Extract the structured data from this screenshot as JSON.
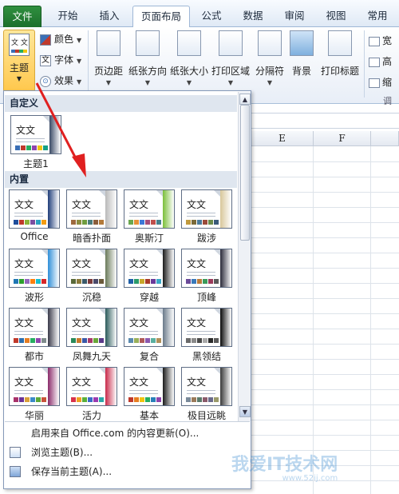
{
  "tabs": [
    "文件",
    "开始",
    "插入",
    "页面布局",
    "公式",
    "数据",
    "审阅",
    "视图",
    "常用"
  ],
  "ribbon": {
    "theme_button": "主题",
    "theme_icon_text": "文 文",
    "small_options": [
      "颜色",
      "字体",
      "效果"
    ],
    "small_option_glyphs": [
      "文",
      "⊙"
    ],
    "big_buttons": [
      "页边距",
      "纸张方向",
      "纸张大小",
      "打印区域",
      "分隔符",
      "背景",
      "打印标题"
    ],
    "right_options": [
      "宽",
      "高",
      "缩"
    ],
    "group_label": "调整"
  },
  "columns": [
    "E",
    "F"
  ],
  "gallery": {
    "section_custom": "自定义",
    "section_builtin": "内置",
    "thumb_text": "文文",
    "custom_themes": [
      {
        "name": "主题1",
        "side": "#3a4a66",
        "colors": [
          "#3b6fb5",
          "#c0392b",
          "#27ae60",
          "#8e44ad",
          "#f1c40f",
          "#16a085"
        ]
      }
    ],
    "builtin_themes": [
      {
        "name": "Office",
        "side": "#1f3d7a",
        "colors": [
          "#1f4e9c",
          "#c0392b",
          "#8bb43a",
          "#7b4fa0",
          "#2aa1c0",
          "#f39c12"
        ]
      },
      {
        "name": "暗香扑面",
        "side": "#b9b9b9",
        "colors": [
          "#9e6a3f",
          "#8c8c3f",
          "#6f9c3f",
          "#4a7d7d",
          "#8b5e3c",
          "#b37a3a"
        ]
      },
      {
        "name": "奥斯汀",
        "side": "#7bbf3a",
        "colors": [
          "#6aa84f",
          "#e69138",
          "#3c78d8",
          "#a64d79",
          "#c0504d",
          "#45818e"
        ]
      },
      {
        "name": "跋涉",
        "side": "#d8c79a",
        "colors": [
          "#c19a3e",
          "#7a6a3a",
          "#4a7a9a",
          "#9a4a3a",
          "#6a8a4a",
          "#3a5a7a"
        ]
      },
      {
        "name": "波形",
        "side": "#2f8fd8",
        "colors": [
          "#1f77b4",
          "#2ca02c",
          "#9467bd",
          "#ff7f0e",
          "#17becf",
          "#d62728"
        ]
      },
      {
        "name": "沉稳",
        "side": "#6a7a5a",
        "colors": [
          "#5a6a3a",
          "#8a7a3a",
          "#3a5a6a",
          "#7a3a3a",
          "#4a4a6a",
          "#6a5a3a"
        ]
      },
      {
        "name": "穿越",
        "side": "#1a1a1a",
        "colors": [
          "#1f5fa8",
          "#2a9a6a",
          "#c8a82a",
          "#a83a2a",
          "#6a3a9a",
          "#3aa8c8"
        ]
      },
      {
        "name": "顶峰",
        "side": "#2a2a3a",
        "colors": [
          "#6a4a9a",
          "#3a7aba",
          "#ba7a3a",
          "#3a9a5a",
          "#9a3a5a",
          "#5a5a5a"
        ]
      },
      {
        "name": "都市",
        "side": "#3a3a4a",
        "colors": [
          "#c0392b",
          "#2c6fb0",
          "#e67e22",
          "#27ae60",
          "#8e44ad",
          "#7f8c8d"
        ]
      },
      {
        "name": "凤舞九天",
        "side": "#2a5a5a",
        "colors": [
          "#2a8a5a",
          "#c8782a",
          "#3a5aa8",
          "#a83a6a",
          "#6aa83a",
          "#5a3a8a"
        ]
      },
      {
        "name": "复合",
        "side": "#6a7a8a",
        "colors": [
          "#5a8ab0",
          "#9ab05a",
          "#b05a5a",
          "#8a5ab0",
          "#5ab0a0",
          "#b0905a"
        ]
      },
      {
        "name": "黑领结",
        "side": "#0a0a0a",
        "colors": [
          "#6a6a6a",
          "#8a8a8a",
          "#4a4a4a",
          "#aaaaaa",
          "#2a2a2a",
          "#5a5a5a"
        ]
      },
      {
        "name": "华丽",
        "side": "#8a2a6a",
        "colors": [
          "#a8326a",
          "#6a3298",
          "#d8a03a",
          "#3a8ac8",
          "#5aa83a",
          "#c8543a"
        ]
      },
      {
        "name": "活力",
        "side": "#c82a4a",
        "colors": [
          "#d8324a",
          "#f0a020",
          "#5ab03a",
          "#3a6ac8",
          "#9a3ab0",
          "#2aa8a8"
        ]
      },
      {
        "name": "基本",
        "side": "#1a1a1a",
        "colors": [
          "#c0392b",
          "#e67e22",
          "#f1c40f",
          "#27ae60",
          "#2980b9",
          "#8e44ad"
        ]
      },
      {
        "name": "极目远眺",
        "side": "#3a3a3a",
        "colors": [
          "#7a8a9a",
          "#9a7a5a",
          "#5a7a6a",
          "#8a5a6a",
          "#6a6a8a",
          "#9a9a6a"
        ]
      }
    ],
    "menu": [
      {
        "label": "启用来自 Office.com 的内容更新(O)...",
        "icon": "none"
      },
      {
        "label": "浏览主题(B)...",
        "icon": "browse-icon"
      },
      {
        "label": "保存当前主题(A)...",
        "icon": "save-icon"
      }
    ]
  },
  "watermark": {
    "text": "我爱IT技术网",
    "sub": "www.52ij.com"
  }
}
